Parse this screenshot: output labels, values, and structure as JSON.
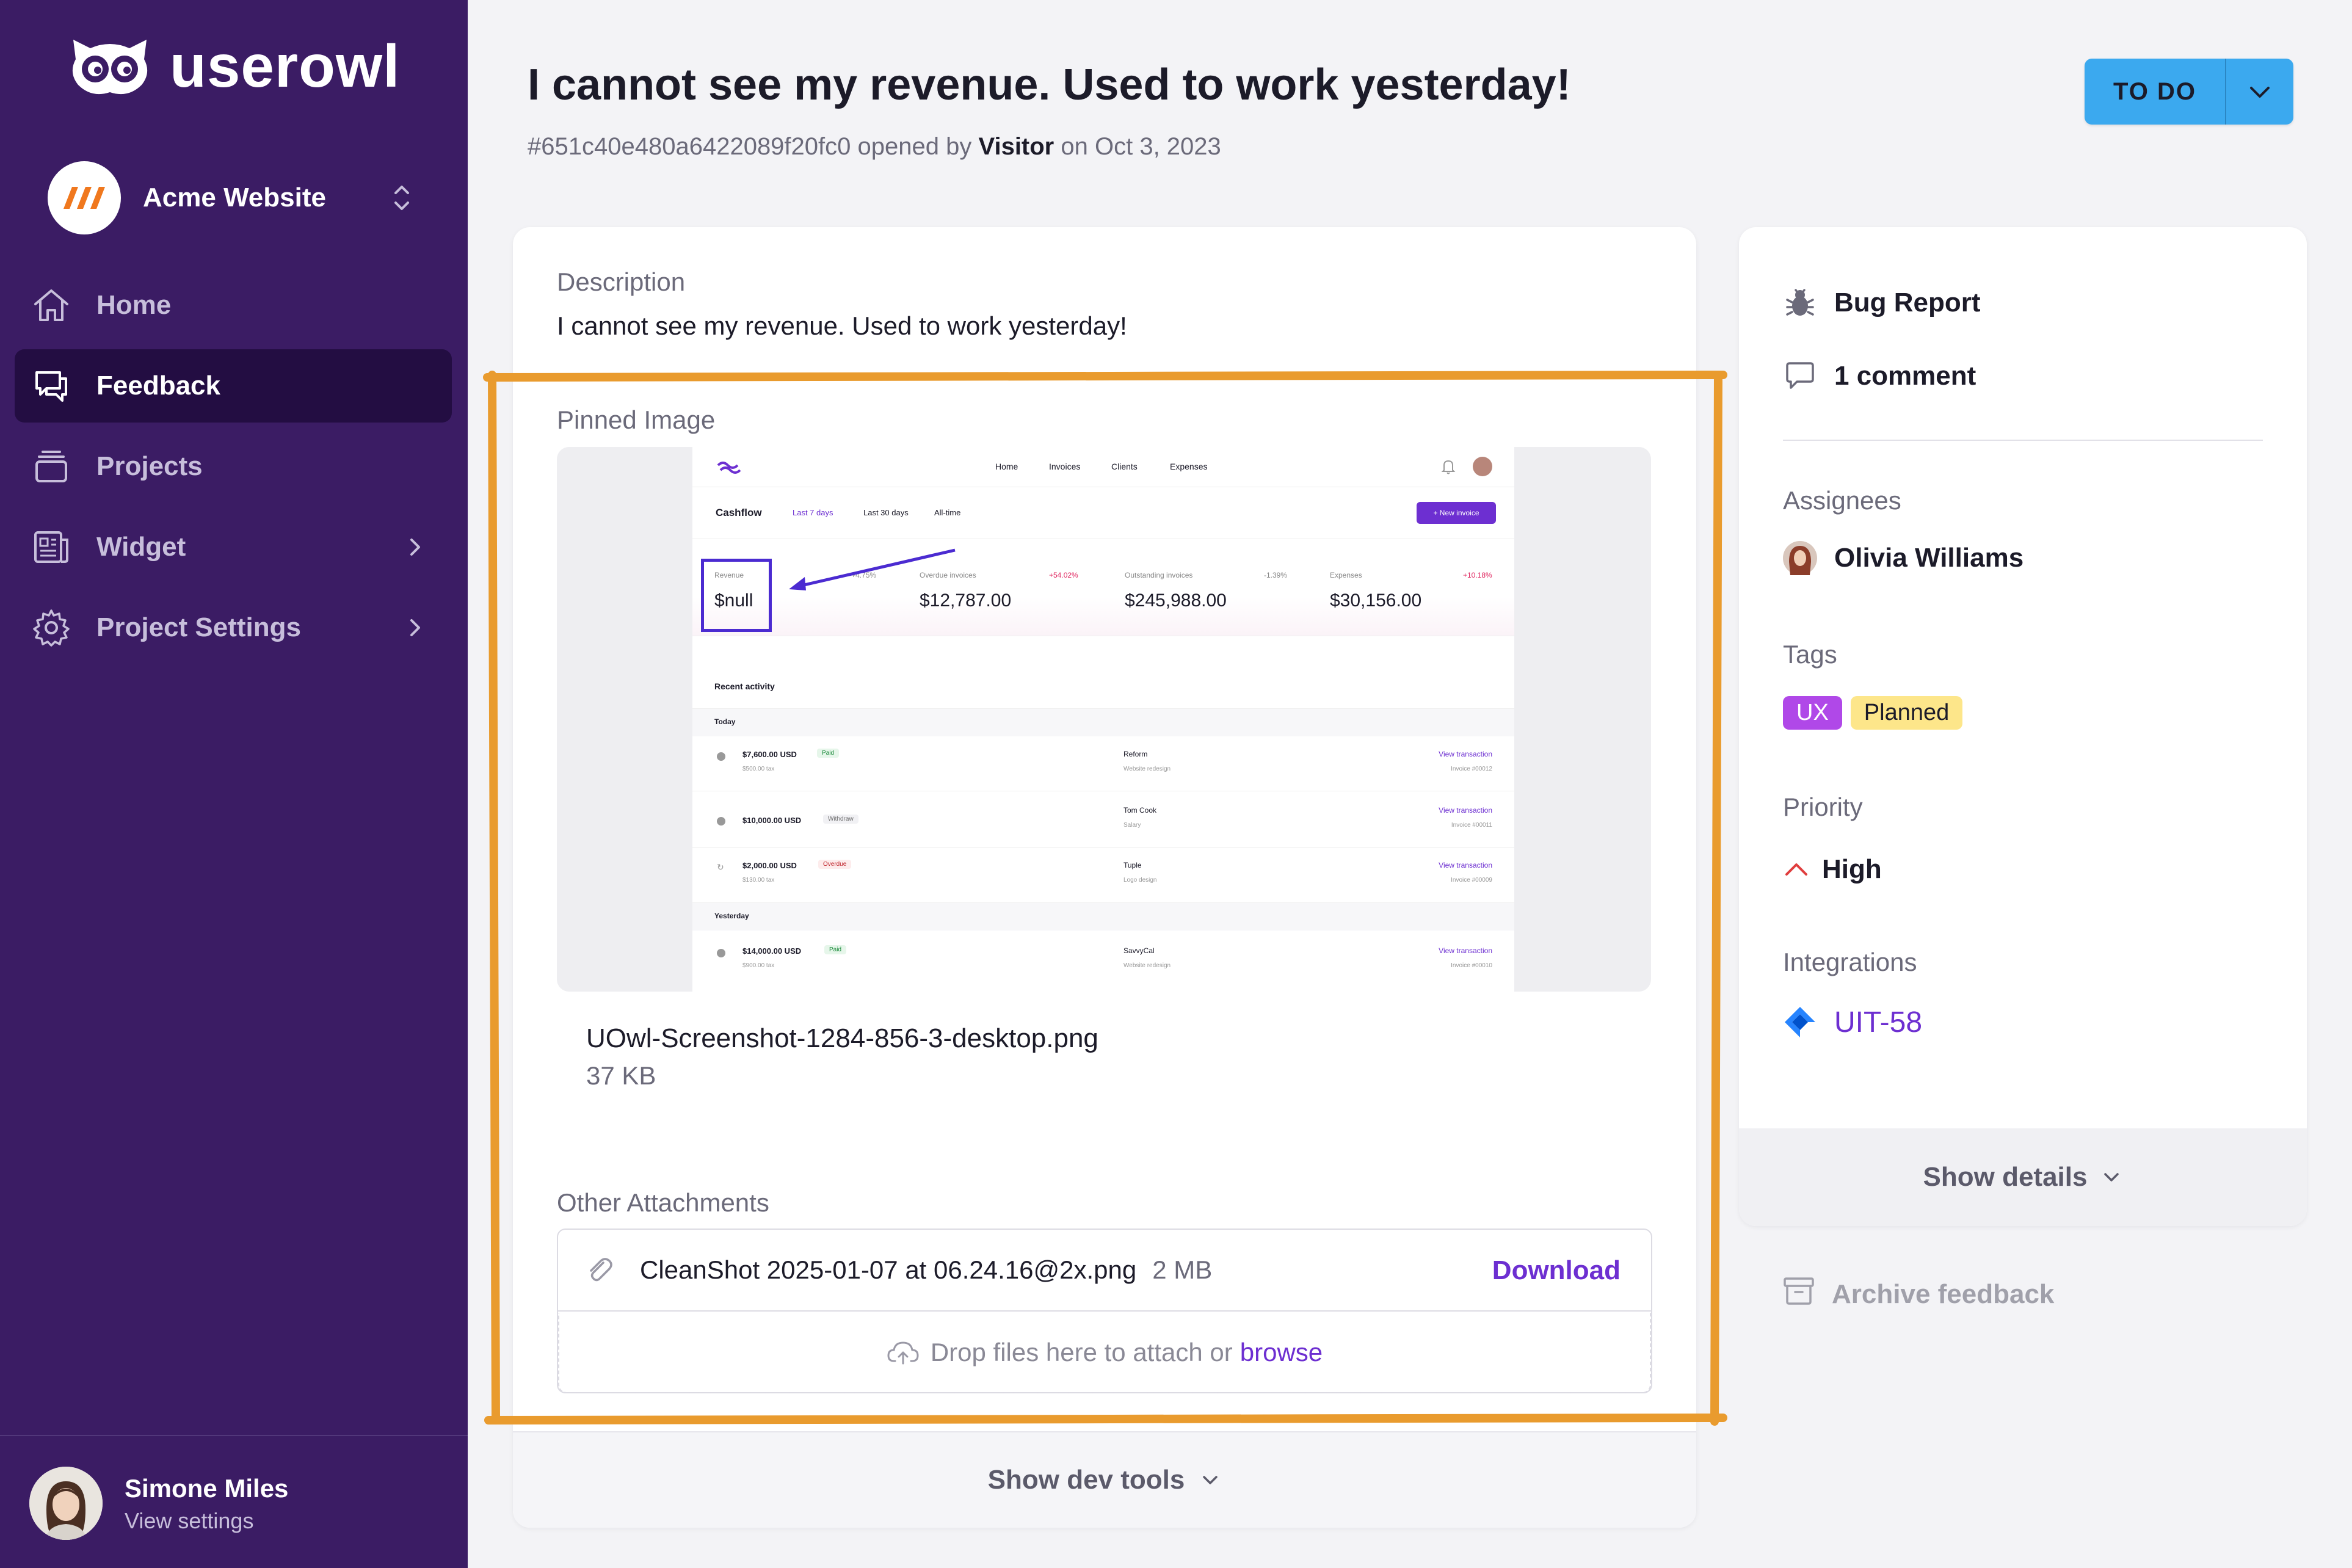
{
  "brand": {
    "name": "userowl"
  },
  "workspace": {
    "name": "Acme Website"
  },
  "nav": [
    {
      "label": "Home",
      "icon": "home-icon"
    },
    {
      "label": "Feedback",
      "icon": "feedback-icon",
      "active": true
    },
    {
      "label": "Projects",
      "icon": "projects-icon"
    },
    {
      "label": "Widget",
      "icon": "widget-icon"
    },
    {
      "label": "Project Settings",
      "icon": "settings-icon"
    }
  ],
  "user": {
    "name": "Simone Miles",
    "sub": "View settings"
  },
  "feedback": {
    "title": "I cannot see my revenue. Used to work yesterday!",
    "id": "#651c40e480a6422089f20fc0",
    "opened_by_text": "opened by",
    "author": "Visitor",
    "date_text": "on Oct 3, 2023",
    "status": "TO DO"
  },
  "main": {
    "description_label": "Description",
    "description": "I cannot see my revenue. Used to work yesterday!",
    "pinned_label": "Pinned Image",
    "pinned_file": {
      "name": "UOwl-Screenshot-1284-856-3-desktop.png",
      "size": "37 KB"
    },
    "other_label": "Other Attachments",
    "attachment": {
      "name": "CleanShot 2025-01-07 at 06.24.16@2x.png",
      "size": "2 MB",
      "action": "Download"
    },
    "drop_text": "Drop files here to attach or",
    "drop_link": "browse",
    "dev_tools": "Show dev tools"
  },
  "side": {
    "type": "Bug Report",
    "comments": "1 comment",
    "assignees_label": "Assignees",
    "assignee": "Olivia Williams",
    "tags_label": "Tags",
    "tags": [
      {
        "label": "UX",
        "bg": "#b048e8",
        "fg": "#ffffff"
      },
      {
        "label": "Planned",
        "bg": "#fde68a",
        "fg": "#1c1b29"
      }
    ],
    "priority_label": "Priority",
    "priority": "High",
    "integrations_label": "Integrations",
    "integration": "UIT-58",
    "show_details": "Show details",
    "archive": "Archive feedback"
  },
  "pinned_screenshot": {
    "nav": [
      "Home",
      "Invoices",
      "Clients",
      "Expenses"
    ],
    "cashflow": "Cashflow",
    "ranges": [
      "Last 7 days",
      "Last 30 days",
      "All-time"
    ],
    "new_invoice": "+ New invoice",
    "stats": [
      {
        "label": "Revenue",
        "change": "+4.75%",
        "value": "$null"
      },
      {
        "label": "Overdue invoices",
        "change": "+54.02%",
        "value": "$12,787.00"
      },
      {
        "label": "Outstanding invoices",
        "change": "-1.39%",
        "value": "$245,988.00"
      },
      {
        "label": "Expenses",
        "change": "+10.18%",
        "value": "$30,156.00"
      }
    ],
    "recent_activity": "Recent activity",
    "today": "Today",
    "yesterday": "Yesterday",
    "rows": [
      {
        "amount": "$7,600.00 USD",
        "badge": "Paid",
        "tax": "$500.00 tax",
        "client": "Reform",
        "desc": "Website redesign",
        "link": "View transaction",
        "inv": "Invoice #00012"
      },
      {
        "amount": "$10,000.00 USD",
        "badge": "Withdraw",
        "tax": "",
        "client": "Tom Cook",
        "desc": "Salary",
        "link": "View transaction",
        "inv": "Invoice #00011"
      },
      {
        "amount": "$2,000.00 USD",
        "badge": "Overdue",
        "tax": "$130.00 tax",
        "client": "Tuple",
        "desc": "Logo design",
        "link": "View transaction",
        "inv": "Invoice #00009"
      },
      {
        "amount": "$14,000.00 USD",
        "badge": "Paid",
        "tax": "$900.00 tax",
        "client": "SavvyCal",
        "desc": "Website redesign",
        "link": "View transaction",
        "inv": "Invoice #00010"
      }
    ]
  },
  "colors": {
    "sidebar": "#3b1c64",
    "accent": "#6d2fd1",
    "status": "#3ba9ef",
    "annotation": "#e99b2e"
  }
}
